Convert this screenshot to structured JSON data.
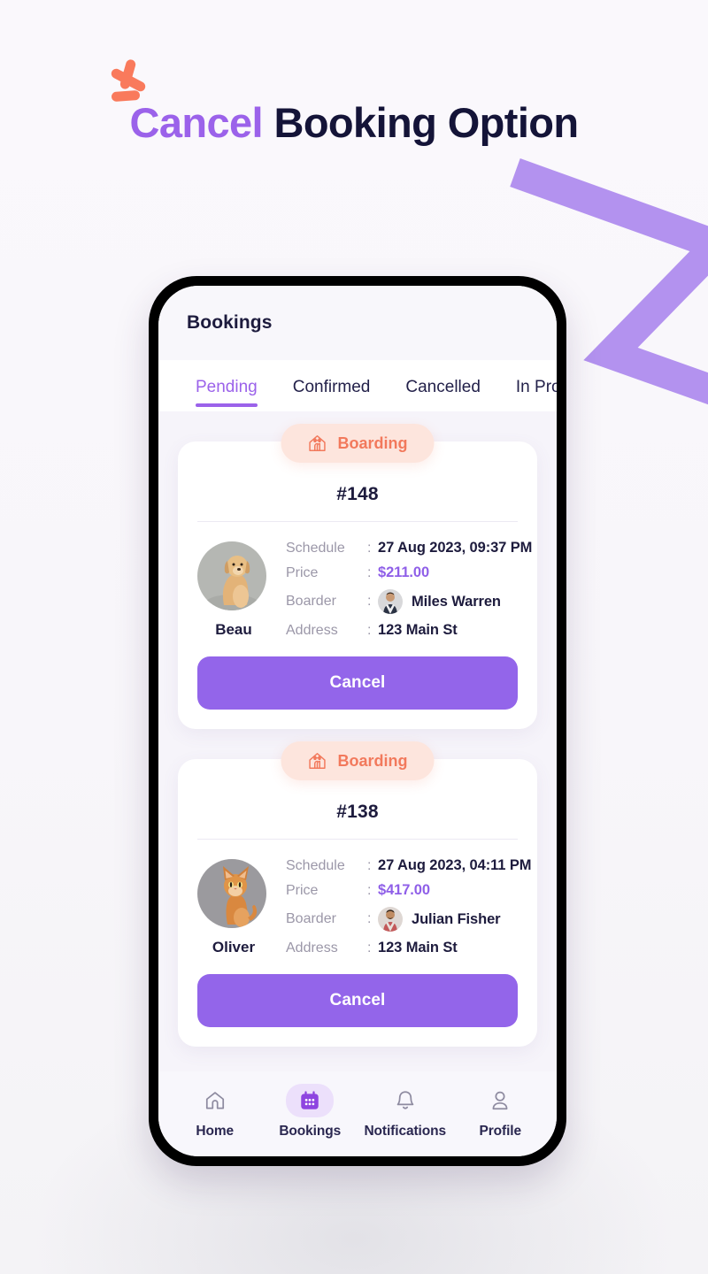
{
  "headline": {
    "accent_text": "Cancel",
    "rest_text": " Booking Option"
  },
  "colors": {
    "accent_purple": "#9b62ea",
    "dark_navy": "#141438",
    "badge_bg": "#fde5dd",
    "badge_text": "#f2795c",
    "price_purple": "#8f5fe8",
    "button_purple": "#9365ea",
    "spark_orange": "#f97a5c",
    "zigzag_purple": "#b392ef"
  },
  "app": {
    "header": {
      "title": "Bookings"
    },
    "tabs": [
      {
        "label": "Pending",
        "active": true
      },
      {
        "label": "Confirmed",
        "active": false
      },
      {
        "label": "Cancelled",
        "active": false
      },
      {
        "label": "In Progress",
        "active": false
      }
    ],
    "bookings": [
      {
        "badge_label": "Boarding",
        "badge_icon": "dog-house-icon",
        "order_no": "#148",
        "pet_name": "Beau",
        "pet_type": "dog",
        "rows": [
          {
            "label": "Schedule",
            "value": "27 Aug 2023, 09:37 PM"
          },
          {
            "label": "Price",
            "value": "$211.00"
          },
          {
            "label": "Boarder",
            "value": "Miles Warren"
          },
          {
            "label": "Address",
            "value": "123 Main St"
          }
        ],
        "action_label": "Cancel"
      },
      {
        "badge_label": "Boarding",
        "badge_icon": "dog-house-icon",
        "order_no": "#138",
        "pet_name": "Oliver",
        "pet_type": "cat",
        "rows": [
          {
            "label": "Schedule",
            "value": "27 Aug 2023, 04:11 PM"
          },
          {
            "label": "Price",
            "value": "$417.00"
          },
          {
            "label": "Boarder",
            "value": "Julian Fisher"
          },
          {
            "label": "Address",
            "value": "123 Main St"
          }
        ],
        "action_label": "Cancel"
      }
    ],
    "bottom_nav": [
      {
        "label": "Home",
        "icon": "home-icon",
        "active": false
      },
      {
        "label": "Bookings",
        "icon": "calendar-icon",
        "active": true
      },
      {
        "label": "Notifications",
        "icon": "bell-icon",
        "active": false
      },
      {
        "label": "Profile",
        "icon": "person-icon",
        "active": false
      }
    ]
  }
}
